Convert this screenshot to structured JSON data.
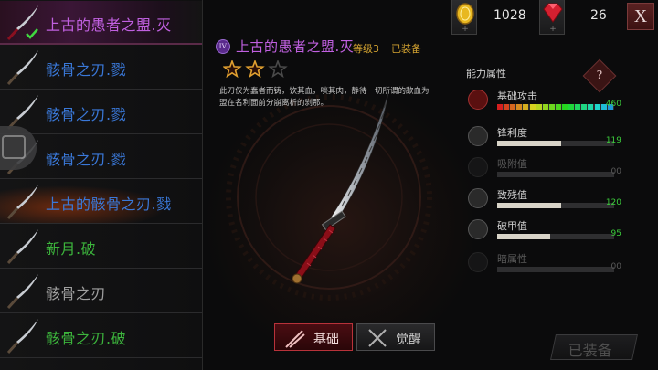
{
  "weapon_list": [
    {
      "name": "上古的愚者之盟.灭",
      "color": "#c060e0",
      "selected": true,
      "equipped": true,
      "highlight": "none"
    },
    {
      "name": "骸骨之刃.戮",
      "color": "#3a78d8",
      "selected": false,
      "equipped": false,
      "highlight": "none"
    },
    {
      "name": "骸骨之刃.戮",
      "color": "#3a78d8",
      "selected": false,
      "equipped": false,
      "highlight": "none"
    },
    {
      "name": "骸骨之刃.戮",
      "color": "#3a78d8",
      "selected": false,
      "equipped": false,
      "highlight": "none"
    },
    {
      "name": "上古的骸骨之刃.戮",
      "color": "#3a78d8",
      "selected": false,
      "equipped": false,
      "highlight": "fire"
    },
    {
      "name": "新月.破",
      "color": "#3cb43c",
      "selected": false,
      "equipped": false,
      "highlight": "none"
    },
    {
      "name": "骸骨之刃",
      "color": "#a0a0a0",
      "selected": false,
      "equipped": false,
      "highlight": "none"
    },
    {
      "name": "骸骨之刃.破",
      "color": "#3cb43c",
      "selected": false,
      "equipped": false,
      "highlight": "none"
    }
  ],
  "currency": {
    "gold": "1028",
    "gem": "26"
  },
  "close_label": "X",
  "detail": {
    "tier": "IV",
    "title": "上古的愚者之盟.灭",
    "level": "等级3",
    "equipped_label": "已装备",
    "stars_filled": 2,
    "stars_total": 3,
    "description": "此刀仅为蠢者而铸，饮其血，啖其肉，静待一切所谓的歃血为盟在名利面前分崩离析的刹那。"
  },
  "tabs": {
    "basic": "基础",
    "awaken": "觉醒"
  },
  "stats": {
    "title": "能力属性",
    "help": "?",
    "items": [
      {
        "label": "基础攻击",
        "value": "460",
        "fraction": 1.0,
        "rainbow": true,
        "dim": false,
        "icon": "attack-icon"
      },
      {
        "label": "锋利度",
        "value": "119",
        "fraction": 0.55,
        "rainbow": false,
        "dim": false,
        "icon": "sharpness-icon"
      },
      {
        "label": "吸附值",
        "value": "00",
        "fraction": 0,
        "rainbow": false,
        "dim": true,
        "icon": "absorb-icon"
      },
      {
        "label": "致残值",
        "value": "120",
        "fraction": 0.55,
        "rainbow": false,
        "dim": false,
        "icon": "cripple-icon"
      },
      {
        "label": "破甲值",
        "value": "95",
        "fraction": 0.45,
        "rainbow": false,
        "dim": false,
        "icon": "armor-break-icon"
      },
      {
        "label": "暗属性",
        "value": "00",
        "fraction": 0,
        "rainbow": false,
        "dim": true,
        "icon": "dark-element-icon"
      }
    ]
  },
  "equip_button": "已装备"
}
